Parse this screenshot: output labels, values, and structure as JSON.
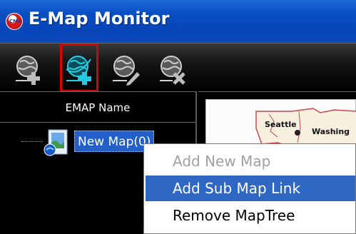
{
  "window": {
    "title": "E-Map Monitor",
    "icon_text": "CMS"
  },
  "toolbar": {
    "buttons": [
      {
        "icon": "add-map-icon",
        "selected": false
      },
      {
        "icon": "add-sub-map-link-icon",
        "selected": true
      },
      {
        "icon": "edit-map-icon",
        "selected": false
      },
      {
        "icon": "remove-map-icon",
        "selected": false
      }
    ]
  },
  "left_panel": {
    "header": "EMAP Name",
    "tree": [
      {
        "label": "New Map(0)",
        "icon": "map-node-icon",
        "selected": true
      }
    ]
  },
  "map": {
    "labels": [
      "Seattle",
      "Washing"
    ]
  },
  "context_menu": {
    "items": [
      {
        "label": "Add New Map",
        "enabled": false,
        "highlighted": false
      },
      {
        "label": "Add Sub Map Link",
        "enabled": true,
        "highlighted": true
      },
      {
        "label": "Remove MapTree",
        "enabled": true,
        "highlighted": false
      }
    ]
  },
  "colors": {
    "titlebar": "#0a4fc4",
    "selection": "#245ec8",
    "menu_highlight": "#2f68c4",
    "toolbar_selected_border": "#e00000"
  }
}
